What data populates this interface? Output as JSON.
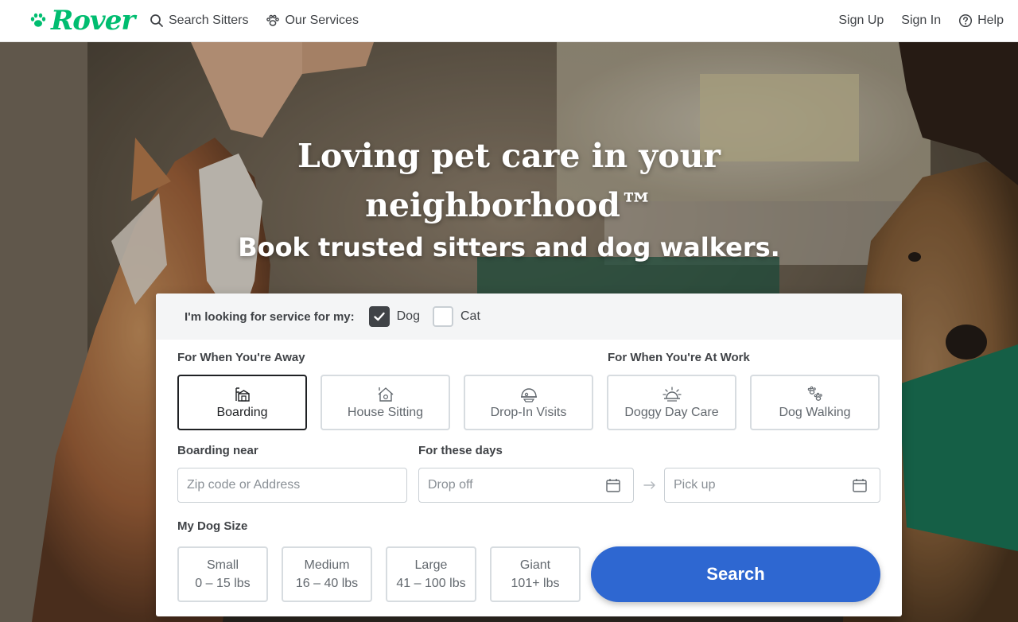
{
  "header": {
    "logo": "Rover",
    "nav_left": [
      {
        "label": "Search Sitters",
        "icon": "search-icon"
      },
      {
        "label": "Our Services",
        "icon": "paw-icon"
      }
    ],
    "nav_right": [
      {
        "label": "Sign Up"
      },
      {
        "label": "Sign In"
      },
      {
        "label": "Help",
        "icon": "help-icon"
      }
    ]
  },
  "hero": {
    "title": "Loving pet care in your neighborhood™",
    "subtitle": "Book trusted sitters and dog walkers."
  },
  "search": {
    "pet_prompt": "I'm looking for service for my:",
    "pets": [
      {
        "label": "Dog",
        "checked": true
      },
      {
        "label": "Cat",
        "checked": false
      }
    ],
    "away_label": "For When You're Away",
    "work_label": "For When You're At Work",
    "services": [
      {
        "label": "Boarding",
        "icon": "boarding-icon",
        "selected": true
      },
      {
        "label": "House Sitting",
        "icon": "house-sitting-icon",
        "selected": false
      },
      {
        "label": "Drop-In Visits",
        "icon": "drop-in-icon",
        "selected": false
      },
      {
        "label": "Doggy Day Care",
        "icon": "day-care-icon",
        "selected": false
      },
      {
        "label": "Dog Walking",
        "icon": "dog-walking-icon",
        "selected": false
      }
    ],
    "location_label": "Boarding near",
    "location_placeholder": "Zip code or Address",
    "dates_label": "For these days",
    "dropoff_placeholder": "Drop off",
    "pickup_placeholder": "Pick up",
    "size_label": "My Dog Size",
    "sizes": [
      {
        "name": "Small",
        "range": "0 – 15 lbs"
      },
      {
        "name": "Medium",
        "range": "16 – 40 lbs"
      },
      {
        "name": "Large",
        "range": "41 – 100 lbs"
      },
      {
        "name": "Giant",
        "range": "101+ lbs"
      }
    ],
    "search_button": "Search"
  },
  "colors": {
    "brand_green": "#00bd70",
    "search_blue": "#2e67d1",
    "text_dark": "#404347"
  }
}
